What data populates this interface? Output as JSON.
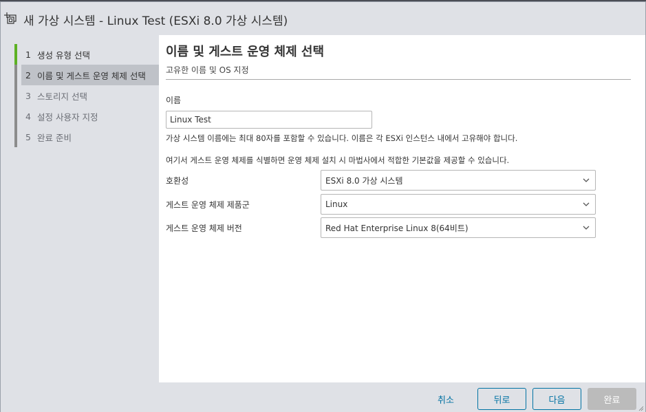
{
  "window": {
    "title": "새 가상 시스템 - Linux Test (ESXi 8.0 가상 시스템)",
    "icon": "new-vm-icon"
  },
  "sidebar": {
    "steps": [
      {
        "num": "1",
        "label": "생성 유형 선택",
        "state": "done"
      },
      {
        "num": "2",
        "label": "이름 및 게스트 운영 체제 선택",
        "state": "active"
      },
      {
        "num": "3",
        "label": "스토리지 선택",
        "state": "pending"
      },
      {
        "num": "4",
        "label": "설정 사용자 지정",
        "state": "pending"
      },
      {
        "num": "5",
        "label": "완료 준비",
        "state": "pending"
      }
    ]
  },
  "main": {
    "heading": "이름 및 게스트 운영 체제 선택",
    "subheading": "고유한 이름 및 OS 지정",
    "name_label": "이름",
    "name_value": "Linux Test",
    "name_help": "가상 시스템 이름에는 최대 80자를 포함할 수 있습니다. 이름은 각 ESXi 인스턴스 내에서 고유해야 합니다.",
    "guest_help": "여기서 게스트 운영 체제를 식별하면 운영 체제 설치 시 마법사에서 적합한 기본값을 제공할 수 있습니다.",
    "compat_label": "호환성",
    "compat_value": "ESXi 8.0 가상 시스템",
    "family_label": "게스트 운영 체제 제품군",
    "family_value": "Linux",
    "version_label": "게스트 운영 체제 버전",
    "version_value": "Red Hat Enterprise Linux 8(64비트)"
  },
  "footer": {
    "cancel": "취소",
    "back": "뒤로",
    "next": "다음",
    "finish": "완료"
  },
  "colors": {
    "accent": "#0072a3",
    "step_done": "#5db124",
    "panel_bg": "#dfe1e6"
  }
}
